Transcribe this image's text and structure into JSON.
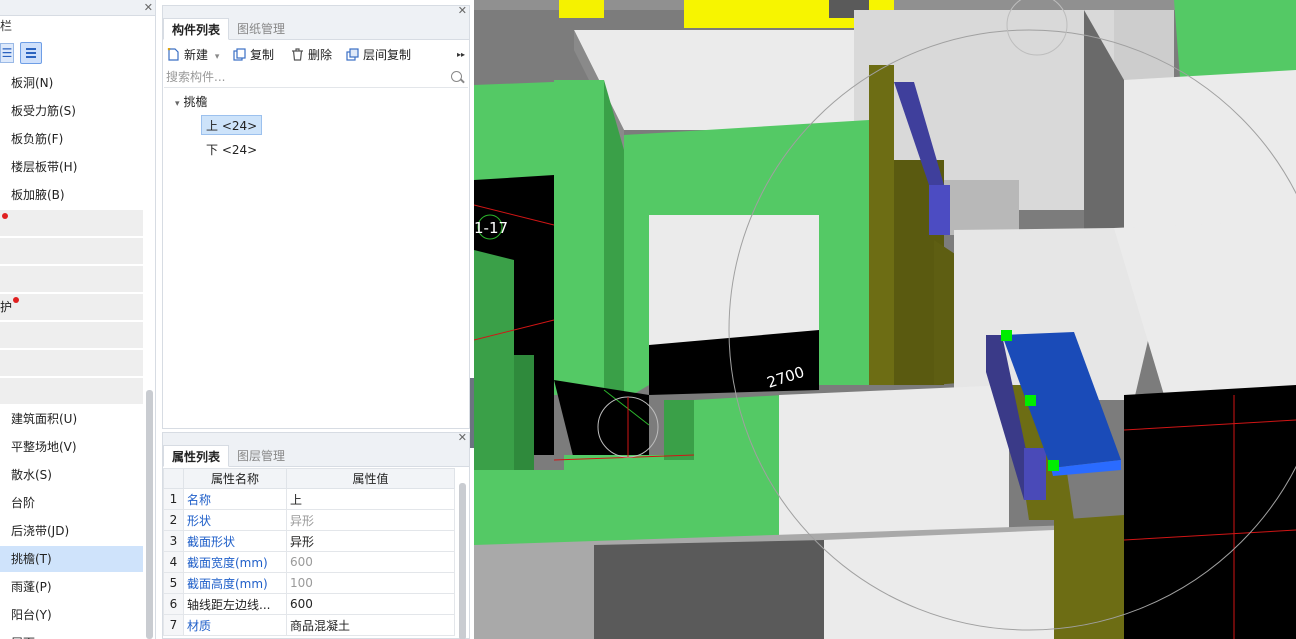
{
  "nav": {
    "title": "栏",
    "view_list_glyph": "☰",
    "items": [
      {
        "label": "板洞(N)"
      },
      {
        "label": "板受力筋(S)"
      },
      {
        "label": "板负筋(F)"
      },
      {
        "label": "楼层板带(H)"
      },
      {
        "label": "板加腋(B)"
      },
      {
        "label": "",
        "collapsed": true
      },
      {
        "label": "",
        "collapsed": true
      },
      {
        "label": "",
        "collapsed": true
      },
      {
        "label": "护",
        "collapsed": true
      },
      {
        "label": "",
        "collapsed": true
      },
      {
        "label": "",
        "collapsed": true
      },
      {
        "label": "",
        "collapsed": true
      },
      {
        "label": "建筑面积(U)"
      },
      {
        "label": "平整场地(V)"
      },
      {
        "label": "散水(S)"
      },
      {
        "label": "台阶"
      },
      {
        "label": "后浇带(JD)"
      },
      {
        "label": "挑檐(T)",
        "selected": true
      },
      {
        "label": "雨蓬(P)"
      },
      {
        "label": "阳台(Y)"
      },
      {
        "label": "屋面"
      }
    ]
  },
  "component_panel": {
    "tabs": [
      {
        "label": "构件列表",
        "active": true
      },
      {
        "label": "图纸管理",
        "active": false
      }
    ],
    "toolbar": {
      "new_label": "新建",
      "new_dropdown": "▾",
      "copy_label": "复制",
      "delete_label": "删除",
      "floor_copy_label": "层间复制",
      "more_glyph": "▸▸"
    },
    "search": {
      "placeholder": "搜索构件..."
    },
    "tree": {
      "group": {
        "toggle": "▾",
        "label": "挑檐"
      },
      "children": [
        {
          "label": "上 <24>",
          "selected": true
        },
        {
          "label": "下 <24>",
          "selected": false
        }
      ]
    }
  },
  "property_panel": {
    "tabs": [
      {
        "label": "属性列表",
        "active": true
      },
      {
        "label": "图层管理",
        "active": false
      }
    ],
    "columns": [
      "属性名称",
      "属性值"
    ],
    "rows": [
      {
        "idx": "1",
        "name": "名称",
        "value": "上",
        "name_blue": true,
        "value_grey": false
      },
      {
        "idx": "2",
        "name": "形状",
        "value": "异形",
        "name_blue": true,
        "value_grey": true
      },
      {
        "idx": "3",
        "name": "截面形状",
        "value": "异形",
        "name_blue": true,
        "value_grey": false
      },
      {
        "idx": "4",
        "name": "截面宽度(mm)",
        "value": "600",
        "name_blue": true,
        "value_grey": true
      },
      {
        "idx": "5",
        "name": "截面高度(mm)",
        "value": "100",
        "name_blue": true,
        "value_grey": true
      },
      {
        "idx": "6",
        "name": "轴线距左边线...",
        "value": "600",
        "name_blue": false,
        "value_grey": false
      },
      {
        "idx": "7",
        "name": "材质",
        "value": "商品混凝土",
        "name_blue": true,
        "value_grey": false
      }
    ]
  },
  "viewport": {
    "axis_label": "1-17",
    "dimension_label": "2700"
  },
  "colors": {
    "wall_green": "#54c965",
    "wall_grey": "#ebebeb",
    "eave_blue": "#1a4bb8",
    "beam_navy": "#3f3f9c",
    "yellow_slab": "#f7f500",
    "olive_face": "#6d6d14",
    "accent_select": "#cfe3fb"
  },
  "icons": {
    "close": "close-icon",
    "new": "new-file-icon",
    "copy": "copy-icon",
    "delete": "trash-icon",
    "floor_copy": "layers-copy-icon",
    "search": "search-icon"
  }
}
